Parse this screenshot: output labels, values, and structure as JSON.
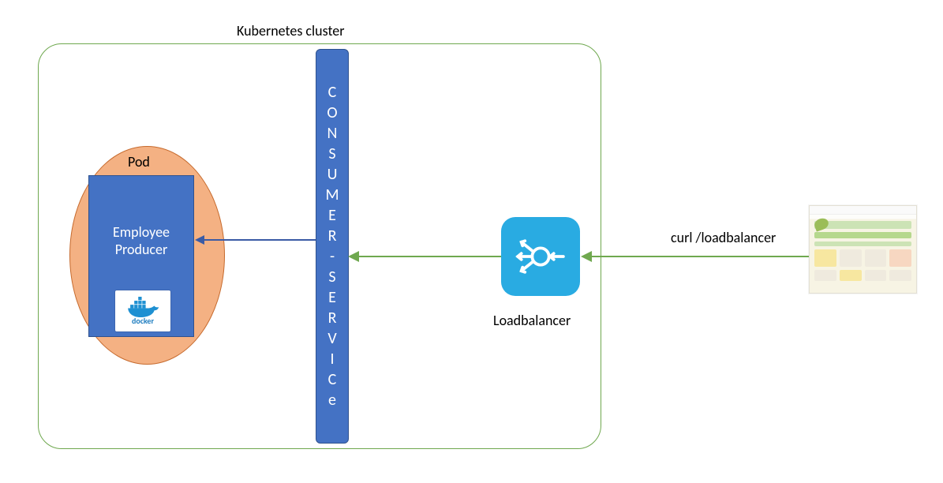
{
  "cluster": {
    "title": "Kubernetes cluster"
  },
  "pod": {
    "label": "Pod"
  },
  "producer": {
    "line1": "Employee",
    "line2": "Producer",
    "docker_label": "docker"
  },
  "consumer": {
    "letters": [
      "C",
      "O",
      "N",
      "S",
      "U",
      "M",
      "E",
      "R",
      "-",
      "S",
      "E",
      "R",
      "V",
      "I",
      "C",
      "e"
    ]
  },
  "loadbalancer": {
    "label": "Loadbalancer"
  },
  "client": {
    "curl_text": "curl /loadbalancer"
  },
  "colors": {
    "cluster_border": "#6fa84f",
    "pod_fill": "#f4b183",
    "box_blue": "#4472c4",
    "lb_blue": "#29abe2",
    "arrow_green": "#6fa84f",
    "arrow_blue": "#3b5ba5"
  }
}
